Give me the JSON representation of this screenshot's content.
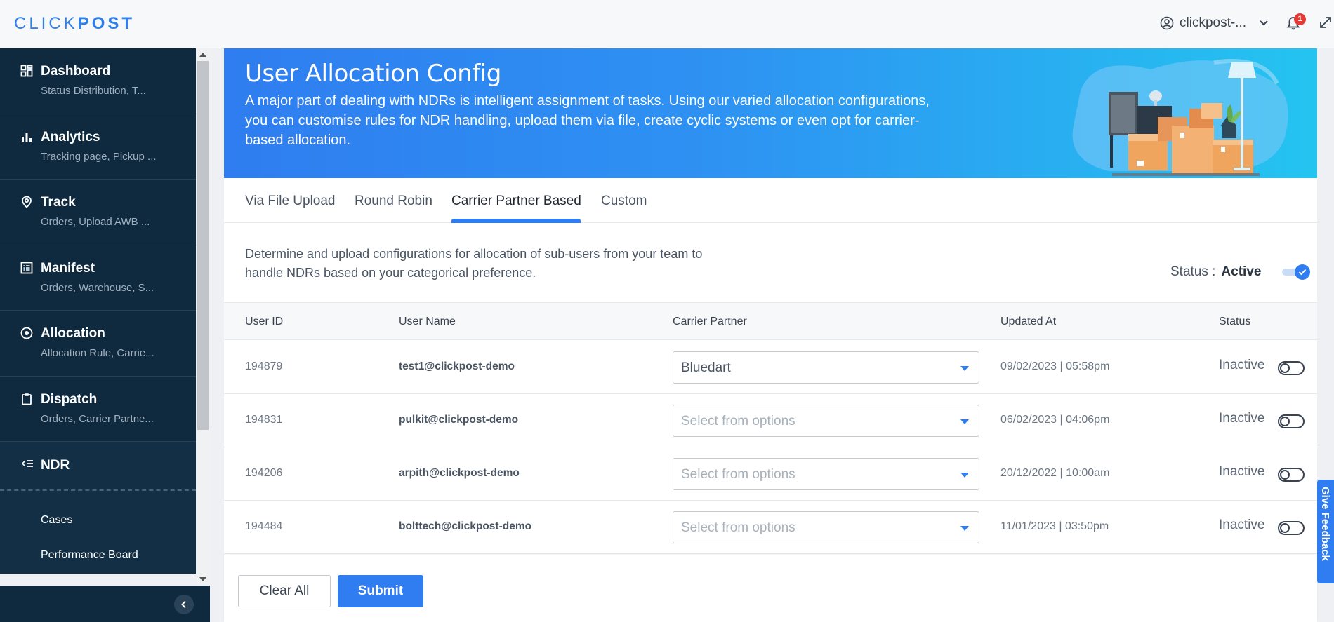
{
  "header": {
    "logo_left": "CLICK",
    "logo_right": "POST",
    "username": "clickpost-...",
    "notification_count": "1"
  },
  "sidebar": {
    "items": [
      {
        "title": "Dashboard",
        "subtitle": "Status Distribution, T...",
        "icon": "dashboard-icon"
      },
      {
        "title": "Analytics",
        "subtitle": "Tracking page, Pickup ...",
        "icon": "analytics-icon"
      },
      {
        "title": "Track",
        "subtitle": "Orders, Upload AWB ...",
        "icon": "location-pin-icon"
      },
      {
        "title": "Manifest",
        "subtitle": "Orders, Warehouse, S...",
        "icon": "manifest-icon"
      },
      {
        "title": "Allocation",
        "subtitle": "Allocation Rule, Carrie...",
        "icon": "allocation-icon"
      },
      {
        "title": "Dispatch",
        "subtitle": "Orders, Carrier Partne...",
        "icon": "clipboard-icon"
      }
    ],
    "ndr": {
      "title": "NDR",
      "icon": "ndr-list-icon",
      "subitems": [
        "Cases",
        "Performance Board"
      ]
    }
  },
  "banner": {
    "title": "User Allocation Config",
    "description": "A major part of dealing with NDRs is intelligent assignment of tasks. Using our varied allocation configurations, you can customise rules for NDR handling, upload them via file, create cyclic systems or even opt for carrier-based allocation."
  },
  "tabs": [
    {
      "label": "Via File Upload"
    },
    {
      "label": "Round Robin"
    },
    {
      "label": "Carrier Partner Based",
      "active": true
    },
    {
      "label": "Custom"
    }
  ],
  "section": {
    "description": "Determine and upload configurations for allocation of sub-users from your team to handle NDRs based on your categorical preference.",
    "status_label": "Status :",
    "status_value": "Active"
  },
  "table": {
    "headers": {
      "user_id": "User ID",
      "user_name": "User Name",
      "carrier_partner": "Carrier Partner",
      "updated_at": "Updated At",
      "status": "Status"
    },
    "placeholder": "Select from options",
    "rows": [
      {
        "user_id": "194879",
        "user_name": "test1@clickpost-demo",
        "carrier": "Bluedart",
        "updated_at": "09/02/2023 | 05:58pm",
        "status": "Inactive"
      },
      {
        "user_id": "194831",
        "user_name": "pulkit@clickpost-demo",
        "carrier": "",
        "updated_at": "06/02/2023 | 04:06pm",
        "status": "Inactive"
      },
      {
        "user_id": "194206",
        "user_name": "arpith@clickpost-demo",
        "carrier": "",
        "updated_at": "20/12/2022 | 10:00am",
        "status": "Inactive"
      },
      {
        "user_id": "194484",
        "user_name": "bolttech@clickpost-demo",
        "carrier": "",
        "updated_at": "11/01/2023 | 03:50pm",
        "status": "Inactive"
      }
    ]
  },
  "actions": {
    "clear_label": "Clear All",
    "submit_label": "Submit"
  },
  "feedback_label": "Give Feedback",
  "colors": {
    "accent": "#2f7df0",
    "sidebar_bg": "#0f2a3f",
    "badge": "#e53935"
  }
}
